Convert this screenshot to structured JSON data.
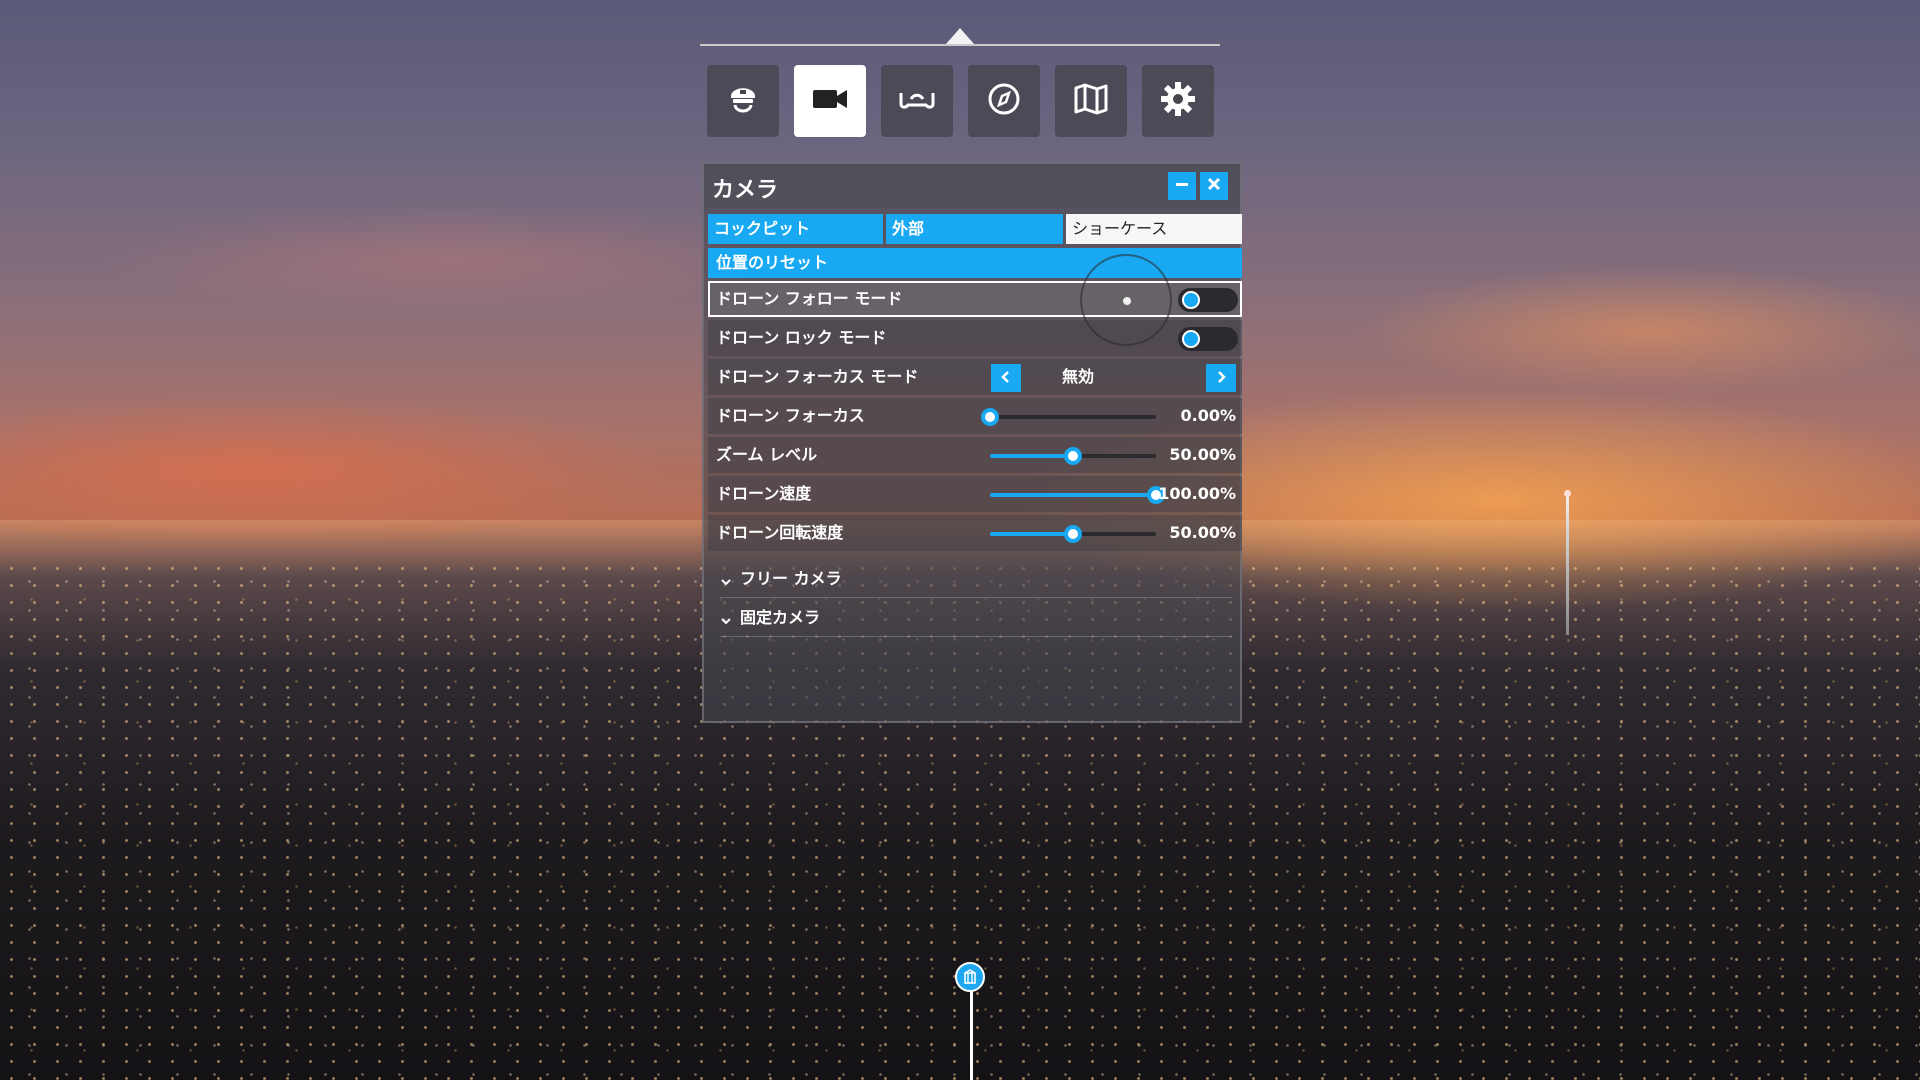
{
  "toolbar": {
    "items": [
      {
        "icon": "pilot-cap-icon",
        "active": false
      },
      {
        "icon": "camera-icon",
        "active": true
      },
      {
        "icon": "yoke-icon",
        "active": false
      },
      {
        "icon": "compass-icon",
        "active": false
      },
      {
        "icon": "map-icon",
        "active": false
      },
      {
        "icon": "gear-icon",
        "active": false
      }
    ]
  },
  "panel": {
    "title": "カメラ",
    "tabs": [
      "コックピット",
      "外部",
      "ショーケース"
    ],
    "reset_label": "位置のリセット",
    "rows": {
      "drone_follow": {
        "label": "ドローン フォロー モード",
        "on": false
      },
      "drone_lock": {
        "label": "ドローン ロック モード",
        "on": false
      },
      "drone_focus_mode": {
        "label": "ドローン フォーカス モード",
        "value": "無効"
      },
      "drone_focus": {
        "label": "ドローン フォーカス",
        "value_text": "0.00%",
        "value": 0.0
      },
      "zoom_level": {
        "label": "ズーム レベル",
        "value_text": "50.00%",
        "value": 50.0
      },
      "drone_speed": {
        "label": "ドローン速度",
        "value_text": "100.00%",
        "value": 100.0
      },
      "drone_rotation_speed": {
        "label": "ドローン回転速度",
        "value_text": "50.00%",
        "value": 50.0
      }
    },
    "sections": [
      "フリー カメラ",
      "固定カメラ"
    ]
  },
  "colors": {
    "accent": "#19a8f2",
    "panel": "#46464e"
  }
}
